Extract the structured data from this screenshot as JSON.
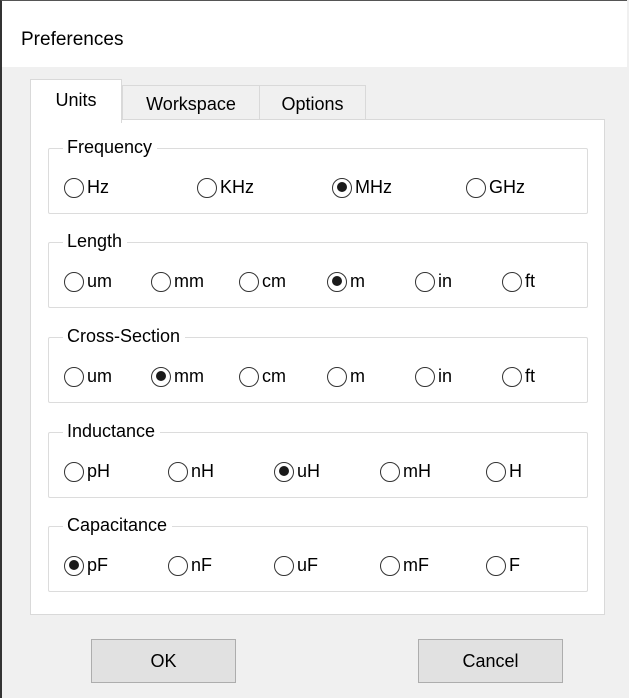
{
  "window": {
    "title": "Preferences"
  },
  "tabs": [
    {
      "label": "Units",
      "active": true
    },
    {
      "label": "Workspace",
      "active": false
    },
    {
      "label": "Options",
      "active": false
    }
  ],
  "groups": {
    "frequency": {
      "label": "Frequency",
      "options": [
        "Hz",
        "KHz",
        "MHz",
        "GHz"
      ],
      "selected": "MHz"
    },
    "length": {
      "label": "Length",
      "options": [
        "um",
        "mm",
        "cm",
        "m",
        "in",
        "ft"
      ],
      "selected": "m"
    },
    "cross_section": {
      "label": "Cross-Section",
      "options": [
        "um",
        "mm",
        "cm",
        "m",
        "in",
        "ft"
      ],
      "selected": "mm"
    },
    "inductance": {
      "label": "Inductance",
      "options": [
        "pH",
        "nH",
        "uH",
        "mH",
        "H"
      ],
      "selected": "uH"
    },
    "capacitance": {
      "label": "Capacitance",
      "options": [
        "pF",
        "nF",
        "uF",
        "mF",
        "F"
      ],
      "selected": "pF"
    }
  },
  "buttons": {
    "ok_label": "OK",
    "cancel_label": "Cancel"
  }
}
